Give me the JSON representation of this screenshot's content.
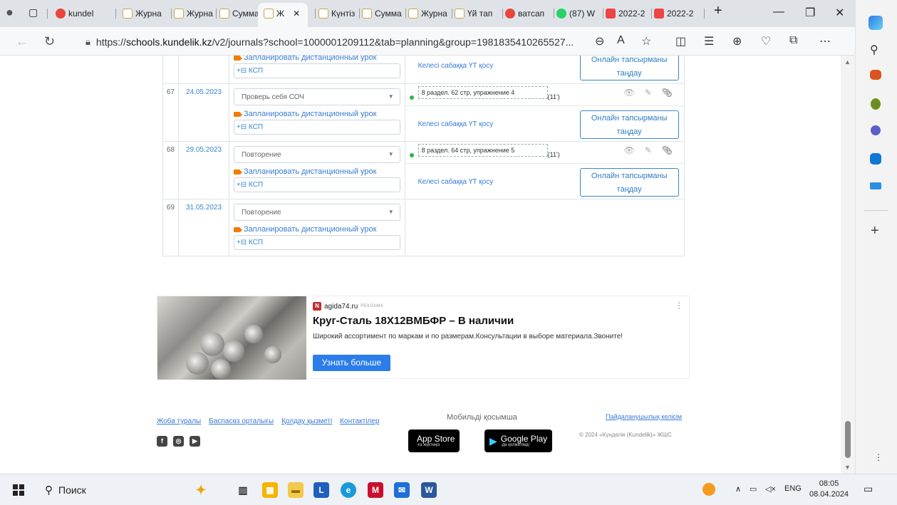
{
  "browser": {
    "tabs": [
      {
        "label": "kundel"
      },
      {
        "label": "Журна"
      },
      {
        "label": "Журна"
      },
      {
        "label": "Сумма"
      },
      {
        "label": "Ж"
      },
      {
        "label": "Күнтіз"
      },
      {
        "label": "Сумма"
      },
      {
        "label": "Журна"
      },
      {
        "label": "Үй тап"
      },
      {
        "label": "ватсап"
      },
      {
        "label": "(87) W"
      },
      {
        "label": "2022-2"
      },
      {
        "label": "2022-2"
      }
    ],
    "url_prefix": "https://",
    "url_host": "schools.kundelik.kz",
    "url_path": "/v2/journals?school=1000001209112&tab=planning&group=1981835410265527..."
  },
  "lessons": [
    {
      "num": "",
      "date": "",
      "topic": "",
      "zoom": "Запланировать дистанционный урок",
      "ksp": "+⊟ КСП",
      "hw": "",
      "time": "",
      "next": "Келесі сабаққа ҮТ қосу",
      "online": "Онлайн тапсырманы таңдау",
      "partial": true
    },
    {
      "num": "67",
      "date": "24.05.2023",
      "topic": "Проверь себя СОЧ",
      "zoom": "Запланировать дистанционный урок",
      "ksp": "+⊟ КСП",
      "hw": "8 раздел. 62 стр, упражнение 4",
      "time": "(11')",
      "next": "Келесі сабаққа ҮТ қосу",
      "online": "Онлайн тапсырманы таңдау"
    },
    {
      "num": "68",
      "date": "29.05.2023",
      "topic": "Повторение",
      "zoom": "Запланировать дистанционный урок",
      "ksp": "+⊟ КСП",
      "hw": "8 раздел. 64 стр, упражнение 5",
      "time": "(11')",
      "next": "Келесі сабаққа ҮТ қосу",
      "online": "Онлайн тапсырманы таңдау"
    },
    {
      "num": "69",
      "date": "31.05.2023",
      "topic": "Повторение",
      "zoom": "Запланировать дистанционный урок",
      "ksp": "+⊟ КСП",
      "hw": "",
      "time": "",
      "next": "",
      "online": ""
    }
  ],
  "ad": {
    "source": "agida74.ru",
    "label": "РЕКЛАМА",
    "title": "Круг-Сталь 18Х12ВМБФР – В наличии",
    "description": "Широкий ассортимент по маркам и по размерам.Консультации в выборе материала.Звоните!",
    "button": "Узнать больше"
  },
  "footer": {
    "links": [
      "Жоба туралы",
      "Баспасөз орталығы",
      "Қолдау қызметі",
      "Контактілер"
    ],
    "mobile_title": "Мобильді қосымша",
    "appstore_big": "App Store",
    "appstore_small": "-ға жүктеңіз",
    "googleplay_big": "Google Play",
    "googleplay_small": "-де қолжетімді",
    "agreement": "Пайдаланушылық келісім",
    "copyright": "© 2024 «Күнделік (Kundelik)» ЖШС"
  },
  "taskbar": {
    "search": "Поиск",
    "lang": "ENG",
    "time": "08:05",
    "date": "08.04.2024"
  },
  "colors": {
    "accent": "#3a87c8",
    "ad_button": "#2b7de9",
    "zoom_icon": "#f07c00",
    "hw_dot": "#2fb24c"
  }
}
